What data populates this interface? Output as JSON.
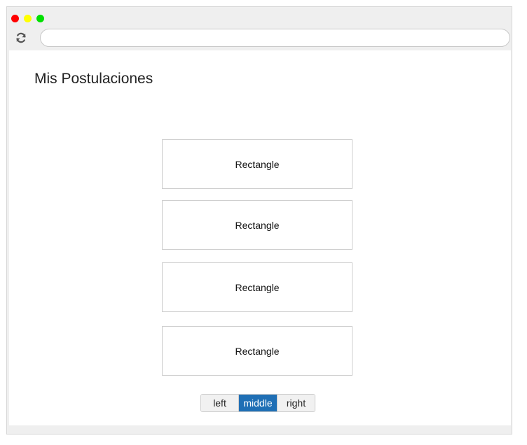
{
  "browser": {
    "address_value": "",
    "reload_icon": "refresh-icon"
  },
  "page": {
    "title": "Mis Postulaciones"
  },
  "rectangles": [
    {
      "label": "Rectangle"
    },
    {
      "label": "Rectangle"
    },
    {
      "label": "Rectangle"
    },
    {
      "label": "Rectangle"
    }
  ],
  "segmented": {
    "options": [
      "left",
      "middle",
      "right"
    ],
    "selected": "middle"
  },
  "colors": {
    "accent": "#1f6fb5",
    "close_dot": "#ff0000",
    "minimize_dot": "#ffff00",
    "maximize_dot": "#00e000"
  }
}
